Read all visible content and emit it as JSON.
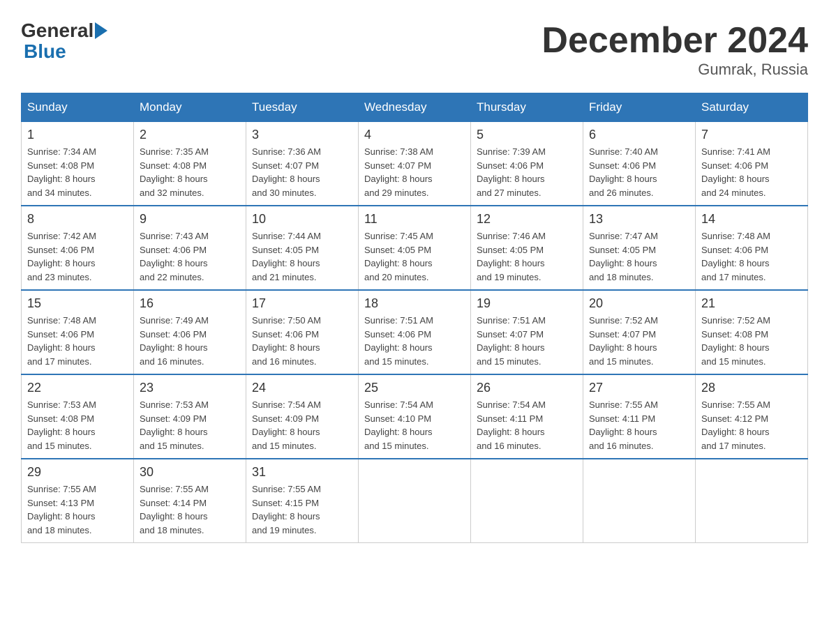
{
  "header": {
    "logo_line1": "General",
    "logo_line2": "Blue",
    "month_title": "December 2024",
    "location": "Gumrak, Russia"
  },
  "weekdays": [
    "Sunday",
    "Monday",
    "Tuesday",
    "Wednesday",
    "Thursday",
    "Friday",
    "Saturday"
  ],
  "weeks": [
    [
      {
        "day": "1",
        "sunrise": "7:34 AM",
        "sunset": "4:08 PM",
        "daylight": "8 hours and 34 minutes."
      },
      {
        "day": "2",
        "sunrise": "7:35 AM",
        "sunset": "4:08 PM",
        "daylight": "8 hours and 32 minutes."
      },
      {
        "day": "3",
        "sunrise": "7:36 AM",
        "sunset": "4:07 PM",
        "daylight": "8 hours and 30 minutes."
      },
      {
        "day": "4",
        "sunrise": "7:38 AM",
        "sunset": "4:07 PM",
        "daylight": "8 hours and 29 minutes."
      },
      {
        "day": "5",
        "sunrise": "7:39 AM",
        "sunset": "4:06 PM",
        "daylight": "8 hours and 27 minutes."
      },
      {
        "day": "6",
        "sunrise": "7:40 AM",
        "sunset": "4:06 PM",
        "daylight": "8 hours and 26 minutes."
      },
      {
        "day": "7",
        "sunrise": "7:41 AM",
        "sunset": "4:06 PM",
        "daylight": "8 hours and 24 minutes."
      }
    ],
    [
      {
        "day": "8",
        "sunrise": "7:42 AM",
        "sunset": "4:06 PM",
        "daylight": "8 hours and 23 minutes."
      },
      {
        "day": "9",
        "sunrise": "7:43 AM",
        "sunset": "4:06 PM",
        "daylight": "8 hours and 22 minutes."
      },
      {
        "day": "10",
        "sunrise": "7:44 AM",
        "sunset": "4:05 PM",
        "daylight": "8 hours and 21 minutes."
      },
      {
        "day": "11",
        "sunrise": "7:45 AM",
        "sunset": "4:05 PM",
        "daylight": "8 hours and 20 minutes."
      },
      {
        "day": "12",
        "sunrise": "7:46 AM",
        "sunset": "4:05 PM",
        "daylight": "8 hours and 19 minutes."
      },
      {
        "day": "13",
        "sunrise": "7:47 AM",
        "sunset": "4:05 PM",
        "daylight": "8 hours and 18 minutes."
      },
      {
        "day": "14",
        "sunrise": "7:48 AM",
        "sunset": "4:06 PM",
        "daylight": "8 hours and 17 minutes."
      }
    ],
    [
      {
        "day": "15",
        "sunrise": "7:48 AM",
        "sunset": "4:06 PM",
        "daylight": "8 hours and 17 minutes."
      },
      {
        "day": "16",
        "sunrise": "7:49 AM",
        "sunset": "4:06 PM",
        "daylight": "8 hours and 16 minutes."
      },
      {
        "day": "17",
        "sunrise": "7:50 AM",
        "sunset": "4:06 PM",
        "daylight": "8 hours and 16 minutes."
      },
      {
        "day": "18",
        "sunrise": "7:51 AM",
        "sunset": "4:06 PM",
        "daylight": "8 hours and 15 minutes."
      },
      {
        "day": "19",
        "sunrise": "7:51 AM",
        "sunset": "4:07 PM",
        "daylight": "8 hours and 15 minutes."
      },
      {
        "day": "20",
        "sunrise": "7:52 AM",
        "sunset": "4:07 PM",
        "daylight": "8 hours and 15 minutes."
      },
      {
        "day": "21",
        "sunrise": "7:52 AM",
        "sunset": "4:08 PM",
        "daylight": "8 hours and 15 minutes."
      }
    ],
    [
      {
        "day": "22",
        "sunrise": "7:53 AM",
        "sunset": "4:08 PM",
        "daylight": "8 hours and 15 minutes."
      },
      {
        "day": "23",
        "sunrise": "7:53 AM",
        "sunset": "4:09 PM",
        "daylight": "8 hours and 15 minutes."
      },
      {
        "day": "24",
        "sunrise": "7:54 AM",
        "sunset": "4:09 PM",
        "daylight": "8 hours and 15 minutes."
      },
      {
        "day": "25",
        "sunrise": "7:54 AM",
        "sunset": "4:10 PM",
        "daylight": "8 hours and 15 minutes."
      },
      {
        "day": "26",
        "sunrise": "7:54 AM",
        "sunset": "4:11 PM",
        "daylight": "8 hours and 16 minutes."
      },
      {
        "day": "27",
        "sunrise": "7:55 AM",
        "sunset": "4:11 PM",
        "daylight": "8 hours and 16 minutes."
      },
      {
        "day": "28",
        "sunrise": "7:55 AM",
        "sunset": "4:12 PM",
        "daylight": "8 hours and 17 minutes."
      }
    ],
    [
      {
        "day": "29",
        "sunrise": "7:55 AM",
        "sunset": "4:13 PM",
        "daylight": "8 hours and 18 minutes."
      },
      {
        "day": "30",
        "sunrise": "7:55 AM",
        "sunset": "4:14 PM",
        "daylight": "8 hours and 18 minutes."
      },
      {
        "day": "31",
        "sunrise": "7:55 AM",
        "sunset": "4:15 PM",
        "daylight": "8 hours and 19 minutes."
      },
      null,
      null,
      null,
      null
    ]
  ]
}
